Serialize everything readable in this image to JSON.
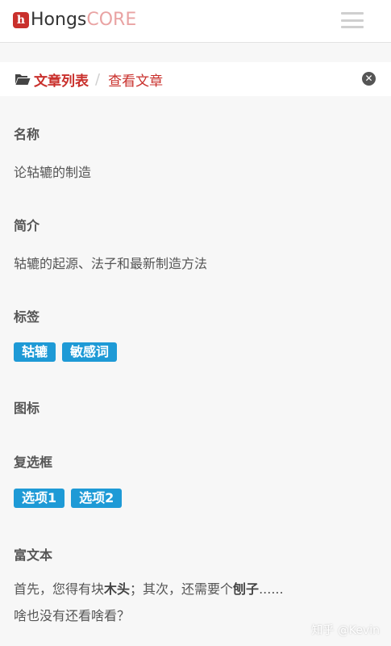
{
  "brand": {
    "logo_letter": "h",
    "name_main": "Hongs",
    "name_accent": "CORE"
  },
  "breadcrumb": {
    "item1": "文章列表",
    "separator": "/",
    "item2": "查看文章"
  },
  "fields": {
    "name": {
      "label": "名称",
      "value": "论轱辘的制造"
    },
    "intro": {
      "label": "简介",
      "value": "轱辘的起源、法子和最新制造方法"
    },
    "tags": {
      "label": "标签",
      "items": [
        "轱辘",
        "敏感词"
      ]
    },
    "icon": {
      "label": "图标"
    },
    "checkbox": {
      "label": "复选框",
      "items": [
        "选项1",
        "选项2"
      ]
    },
    "richtext": {
      "label": "富文本",
      "line1_a": "首先，您得有块",
      "line1_b": "木头",
      "line1_c": "；其次，还需要个",
      "line1_d": "刨子",
      "line1_e": "......",
      "line2": "啥也没有还看啥看？"
    }
  },
  "watermark": "知乎 @Kevin",
  "colors": {
    "accent": "#c9302c",
    "tag": "#1e9ad6"
  },
  "icons": {
    "folder": "folder-open-icon",
    "close": "close-circle-icon",
    "menu": "hamburger-menu-icon"
  }
}
